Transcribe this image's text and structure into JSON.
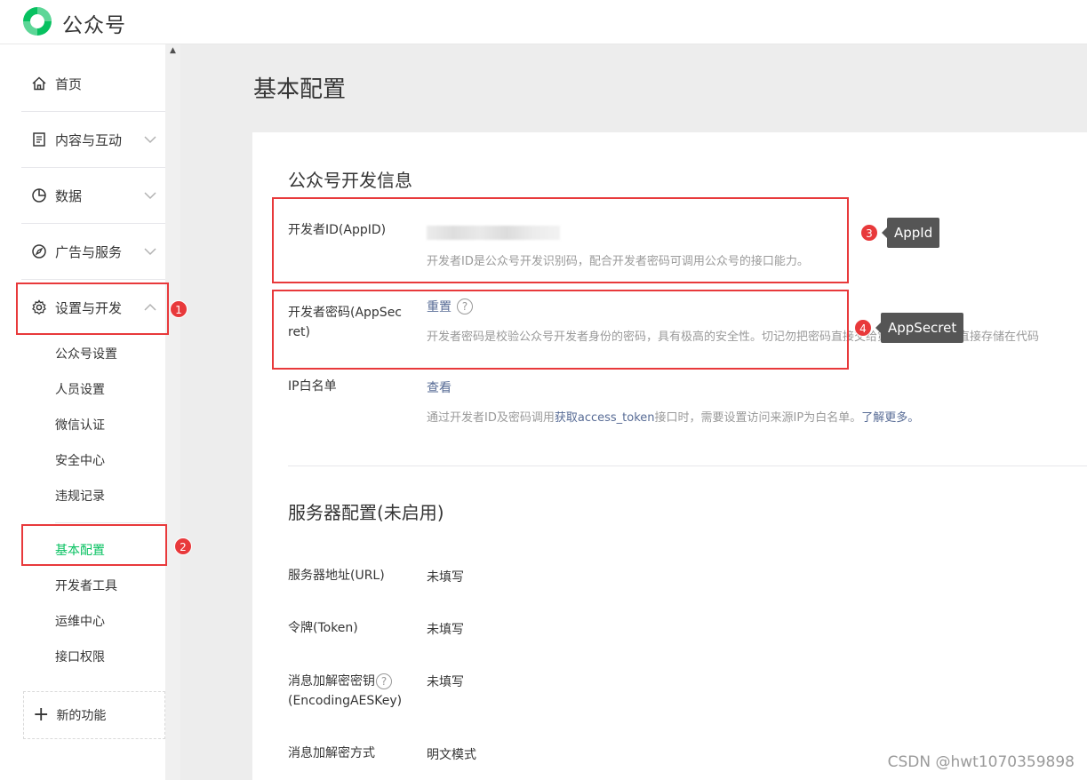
{
  "app": {
    "brand": "公众号"
  },
  "sidebar": {
    "nav": [
      {
        "label": "首页",
        "icon": "home-icon"
      },
      {
        "label": "内容与互动",
        "icon": "document-icon"
      },
      {
        "label": "数据",
        "icon": "pie-chart-icon"
      },
      {
        "label": "广告与服务",
        "icon": "compass-icon"
      },
      {
        "label": "设置与开发",
        "icon": "gear-icon"
      }
    ],
    "sub_items": [
      {
        "label": "公众号设置"
      },
      {
        "label": "人员设置"
      },
      {
        "label": "微信认证"
      },
      {
        "label": "安全中心"
      },
      {
        "label": "违规记录"
      },
      {
        "label": "基本配置",
        "active": true
      },
      {
        "label": "开发者工具"
      },
      {
        "label": "运维中心"
      },
      {
        "label": "接口权限"
      }
    ],
    "new_feature": "新的功能"
  },
  "page": {
    "title": "基本配置"
  },
  "dev_info": {
    "title": "公众号开发信息",
    "appid": {
      "label": "开发者ID(AppID)",
      "desc": "开发者ID是公众号开发识别码，配合开发者密码可调用公众号的接口能力。"
    },
    "appsecret": {
      "label_line1": "开发者密码(AppSec",
      "label_line2": "ret)",
      "action": "重置",
      "desc": "开发者密码是校验公众号开发者身份的密码，具有极高的安全性。切记勿把密码直接交给第三方开发者或直接存储在代码"
    },
    "ip_whitelist": {
      "label": "IP白名单",
      "action": "查看",
      "desc_pre": "通过开发者ID及密码调用",
      "desc_link": "获取access_token",
      "desc_mid": "接口时，需要设置访问来源IP为白名单。",
      "desc_more": "了解更多。"
    }
  },
  "server": {
    "title": "服务器配置(未启用)",
    "rows": [
      {
        "label": "服务器地址(URL)",
        "value": "未填写"
      },
      {
        "label": "令牌(Token)",
        "value": "未填写"
      },
      {
        "label": "消息加解密密钥",
        "label2": "(EncodingAESKey)",
        "value": "未填写"
      },
      {
        "label": "消息加解密方式",
        "value": "明文模式"
      }
    ]
  },
  "annotations": {
    "badges": [
      "1",
      "2",
      "3",
      "4"
    ],
    "tips": [
      "AppId",
      "AppSecret"
    ],
    "color": "#e8393b"
  },
  "watermark": "CSDN @hwt1070359898",
  "colors": {
    "accent": "#07c160",
    "link": "#576b95"
  }
}
